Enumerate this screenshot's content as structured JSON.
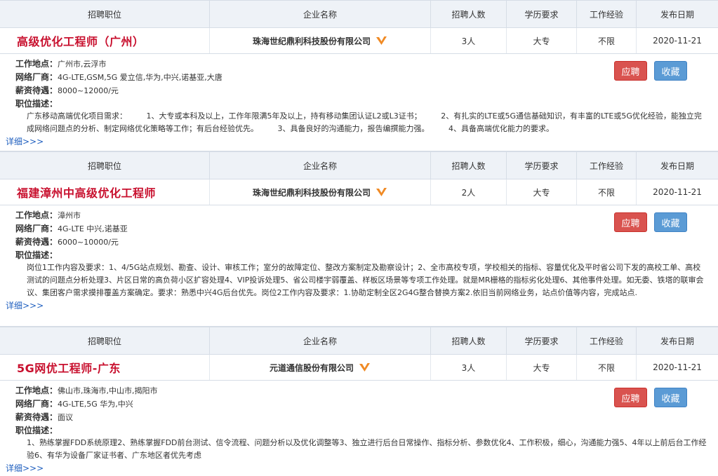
{
  "headers": {
    "position": "招聘职位",
    "company": "企业名称",
    "count": "招聘人数",
    "education": "学历要求",
    "experience": "工作经验",
    "date": "发布日期"
  },
  "labels": {
    "location": "工作地点：",
    "vendor": "网络厂商：",
    "salary": "薪资待遇：",
    "desc": "职位描述：",
    "apply": "应聘",
    "save": "收藏",
    "more": "详细>>>"
  },
  "colors": {
    "title": "#c8102e",
    "apply": "#d9534f",
    "save": "#5b9bd5",
    "verified": "#f08a24"
  },
  "jobs": [
    {
      "title": "高级优化工程师（广州）",
      "company": "珠海世纪鼎利科技股份有限公司",
      "count": "3人",
      "education": "大专",
      "experience": "不限",
      "date": "2020-11-21",
      "location": "广州市,云浮市",
      "vendor": "4G-LTE,GSM,5G 爱立信,华为,中兴,诺基亚,大唐",
      "salary": "8000~12000/元",
      "desc": "广东移动高端优化项目需求：　　　1、大专或本科及以上，工作年限满5年及以上，持有移动集团认证L2或L3证书；　　　2、有扎实的LTE或5G通信基础知识，有丰富的LTE或5G优化经验，能独立完成网络问题点的分析、制定网络优化策略等工作；有后台经验优先。　　　3、具备良好的沟通能力，报告编撰能力强。　　　4、具备高端优化能力的要求。"
    },
    {
      "title": "福建漳州中高级优化工程师",
      "company": "珠海世纪鼎利科技股份有限公司",
      "count": "2人",
      "education": "大专",
      "experience": "不限",
      "date": "2020-11-21",
      "location": "漳州市",
      "vendor": "4G-LTE 中兴,诺基亚",
      "salary": "6000~10000/元",
      "desc": "岗位1工作内容及要求：1、4/5G站点规划、勘查、设计、审核工作；室分的故障定位、整改方案制定及勘察设计；2、全市高校专项，学校相关的指标、容量优化及平时省公司下发的高校工单、高校测试的问题点分析处理3、片区日常的高负荷小区扩容处理4、VIP投诉处理5、省公司楼宇弱覆盖、样板区场景等专项工作处理。就是MR栅格的指标劣化处理6、其他事件处理。如无委、铁塔的联审会议、集团客户需求摸排覆盖方案确定。要求：熟悉中兴4G后台优先。岗位2工作内容及要求：1.协助定制全区2G4G整合替换方案2.依旧当前网络业务，站点价值等内容，完成站点."
    },
    {
      "title": "5G网优工程师-广东",
      "company": "元道通信股份有限公司",
      "count": "3人",
      "education": "大专",
      "experience": "不限",
      "date": "2020-11-21",
      "location": "佛山市,珠海市,中山市,揭阳市",
      "vendor": "4G-LTE,5G 华为,中兴",
      "salary": "面议",
      "desc": "1、熟练掌握FDD系统原理2、熟练掌握FDD前台测试、信令流程、问题分析以及优化调整等3、独立进行后台日常操作、指标分析、参数优化4、工作积极，细心，沟通能力强5、4年以上前后台工作经验6、有华为设备厂家证书者、广东地区者优先考虑"
    }
  ]
}
